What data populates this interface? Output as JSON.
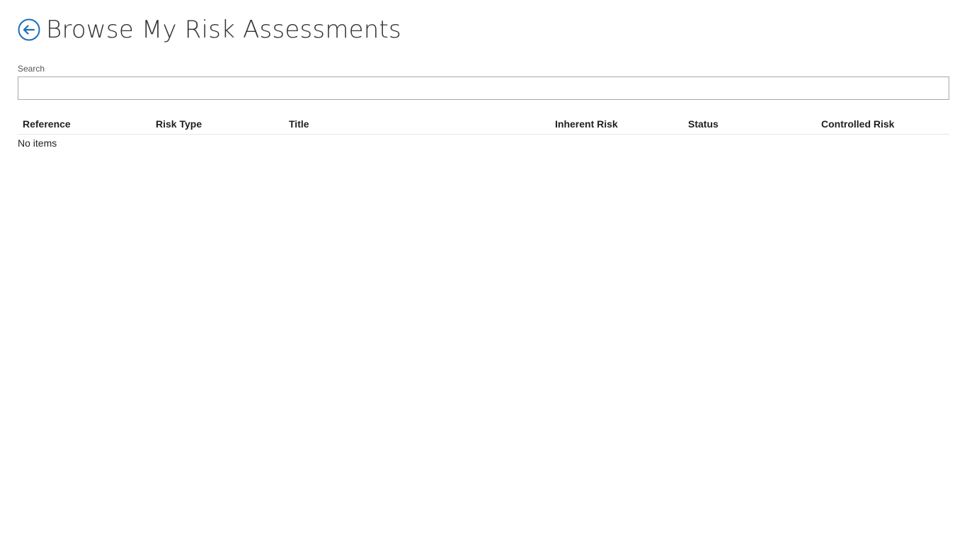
{
  "header": {
    "title": "Browse My Risk Assessments",
    "back_icon": "back-arrow-circle-icon",
    "accent_color": "#1a6fb5"
  },
  "search": {
    "label": "Search",
    "value": "",
    "placeholder": ""
  },
  "table": {
    "columns": [
      "Reference",
      "Risk Type",
      "Title",
      "Inherent Risk",
      "Status",
      "Controlled Risk"
    ],
    "rows": [],
    "empty_message": "No items"
  }
}
